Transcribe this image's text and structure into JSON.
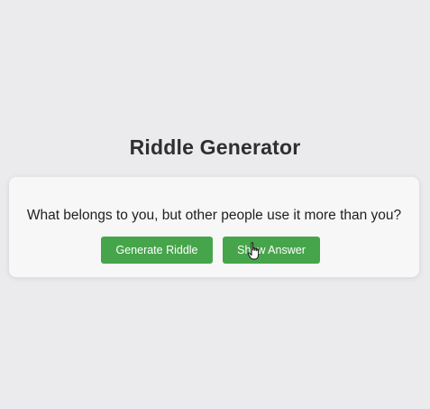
{
  "app": {
    "title": "Riddle Generator"
  },
  "riddle": {
    "question": "What belongs to you, but other people use it more than you?"
  },
  "buttons": {
    "generate_label": "Generate Riddle",
    "answer_label": "Show Answer"
  },
  "colors": {
    "background": "#ebeaec",
    "card": "#f7f7f8",
    "button": "#46a54a",
    "button_text": "#ffffff",
    "title_text": "#2f2f2f"
  },
  "icons": {
    "cursor": "hand-pointer-icon"
  }
}
